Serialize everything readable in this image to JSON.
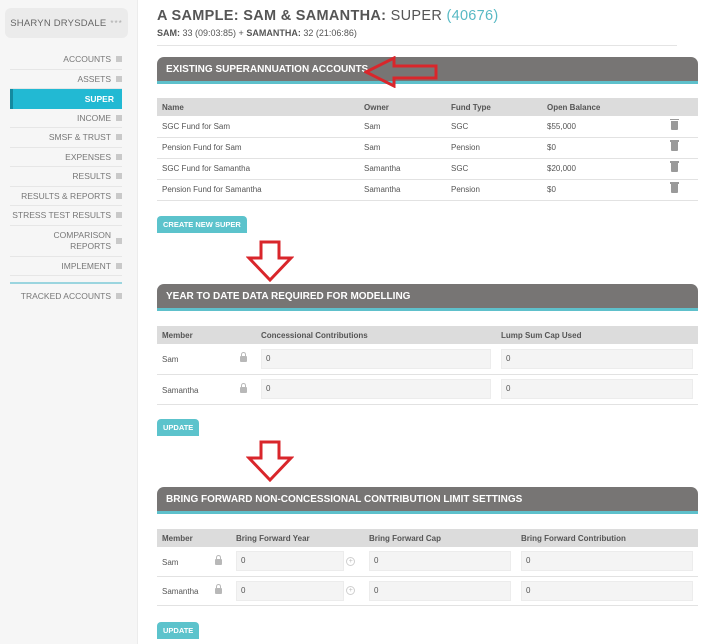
{
  "user": {
    "name": "SHARYN DRYSDALE",
    "more": "***"
  },
  "nav": [
    {
      "label": "ACCOUNTS",
      "active": false
    },
    {
      "label": "ASSETS",
      "active": false
    },
    {
      "label": "SUPER",
      "active": true
    },
    {
      "label": "INCOME",
      "active": false
    },
    {
      "label": "SMSF & TRUST",
      "active": false
    },
    {
      "label": "EXPENSES",
      "active": false
    },
    {
      "label": "RESULTS",
      "active": false
    },
    {
      "label": "RESULTS & REPORTS",
      "active": false
    },
    {
      "label": "STRESS TEST RESULTS",
      "active": false
    },
    {
      "label": "COMPARISON REPORTS",
      "active": false
    },
    {
      "label": "IMPLEMENT",
      "active": false
    },
    {
      "label": "TRACKED ACCOUNTS",
      "active": false
    }
  ],
  "page": {
    "title_bold": "A SAMPLE: SAM & SAMANTHA:",
    "title_section": "SUPER",
    "title_code": "(40676)",
    "subtitle": {
      "p1_name": "SAM:",
      "p1_age": "33 (09:03:85) +",
      "p2_name": "SAMANTHA:",
      "p2_age": "32 (21:06:86)"
    }
  },
  "super_accounts": {
    "header": "EXISTING SUPERANNUATION ACCOUNTS",
    "columns": [
      "Name",
      "Owner",
      "Fund Type",
      "Open Balance"
    ],
    "rows": [
      {
        "name": "SGC Fund for Sam",
        "owner": "Sam",
        "fund_type": "SGC",
        "balance": "$55,000"
      },
      {
        "name": "Pension Fund for Sam",
        "owner": "Sam",
        "fund_type": "Pension",
        "balance": "$0"
      },
      {
        "name": "SGC Fund for Samantha",
        "owner": "Samantha",
        "fund_type": "SGC",
        "balance": "$20,000"
      },
      {
        "name": "Pension Fund for Samantha",
        "owner": "Samantha",
        "fund_type": "Pension",
        "balance": "$0"
      }
    ],
    "button": "CREATE NEW SUPER"
  },
  "ytd": {
    "header": "YEAR TO DATE DATA REQUIRED FOR MODELLING",
    "columns": [
      "Member",
      "Concessional Contributions",
      "Lump Sum Cap Used"
    ],
    "rows": [
      {
        "member": "Sam",
        "concessional": "0",
        "lump_sum": "0"
      },
      {
        "member": "Samantha",
        "concessional": "0",
        "lump_sum": "0"
      }
    ],
    "button": "UPDATE"
  },
  "bring_forward": {
    "header": "BRING FORWARD NON-CONCESSIONAL CONTRIBUTION LIMIT SETTINGS",
    "columns": [
      "Member",
      "Bring Forward Year",
      "Bring Forward Cap",
      "Bring Forward Contribution"
    ],
    "rows": [
      {
        "member": "Sam",
        "year": "0",
        "cap": "0",
        "contribution": "0"
      },
      {
        "member": "Samantha",
        "year": "0",
        "cap": "0",
        "contribution": "0"
      }
    ],
    "button": "UPDATE"
  },
  "icons": {
    "delete": "trash-icon",
    "lock": "lock-icon",
    "spinner": "stepper-icon",
    "annotation": "red-arrow-icon"
  },
  "colors": {
    "accent": "#22b9d3",
    "header_bg": "#777574",
    "annotation": "#d9262b"
  }
}
